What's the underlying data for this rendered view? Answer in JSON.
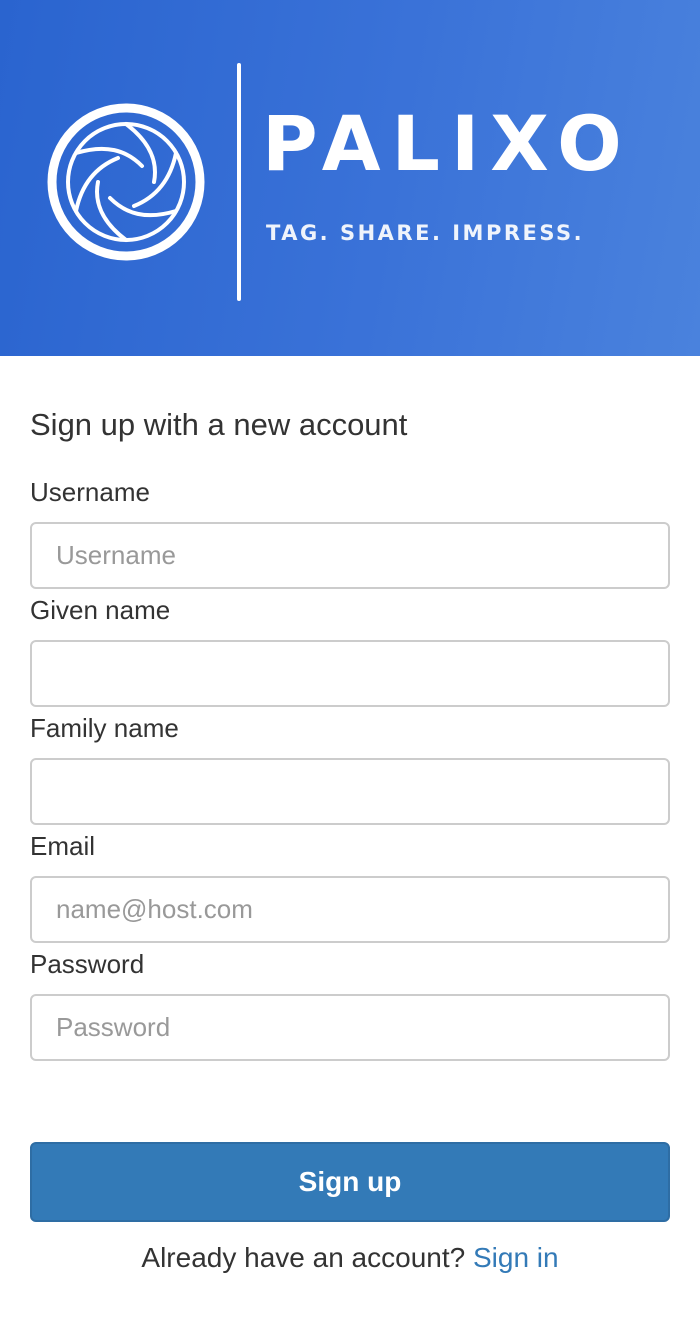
{
  "brand": {
    "name": "PALIXO",
    "tagline": "TAG. SHARE. IMPRESS.",
    "logo_icon": "camera-aperture-icon",
    "banner_color": "#2a64cf"
  },
  "form": {
    "title": "Sign up with a new account",
    "fields": [
      {
        "label": "Username",
        "placeholder": "Username",
        "value": ""
      },
      {
        "label": "Given name",
        "placeholder": "",
        "value": ""
      },
      {
        "label": "Family name",
        "placeholder": "",
        "value": ""
      },
      {
        "label": "Email",
        "placeholder": "name@host.com",
        "value": ""
      },
      {
        "label": "Password",
        "placeholder": "Password",
        "value": ""
      }
    ],
    "submit_label": "Sign up",
    "submit_color": "#337ab7",
    "footer_text": "Already have an account?",
    "footer_link": "Sign in",
    "link_color": "#337ab7"
  }
}
